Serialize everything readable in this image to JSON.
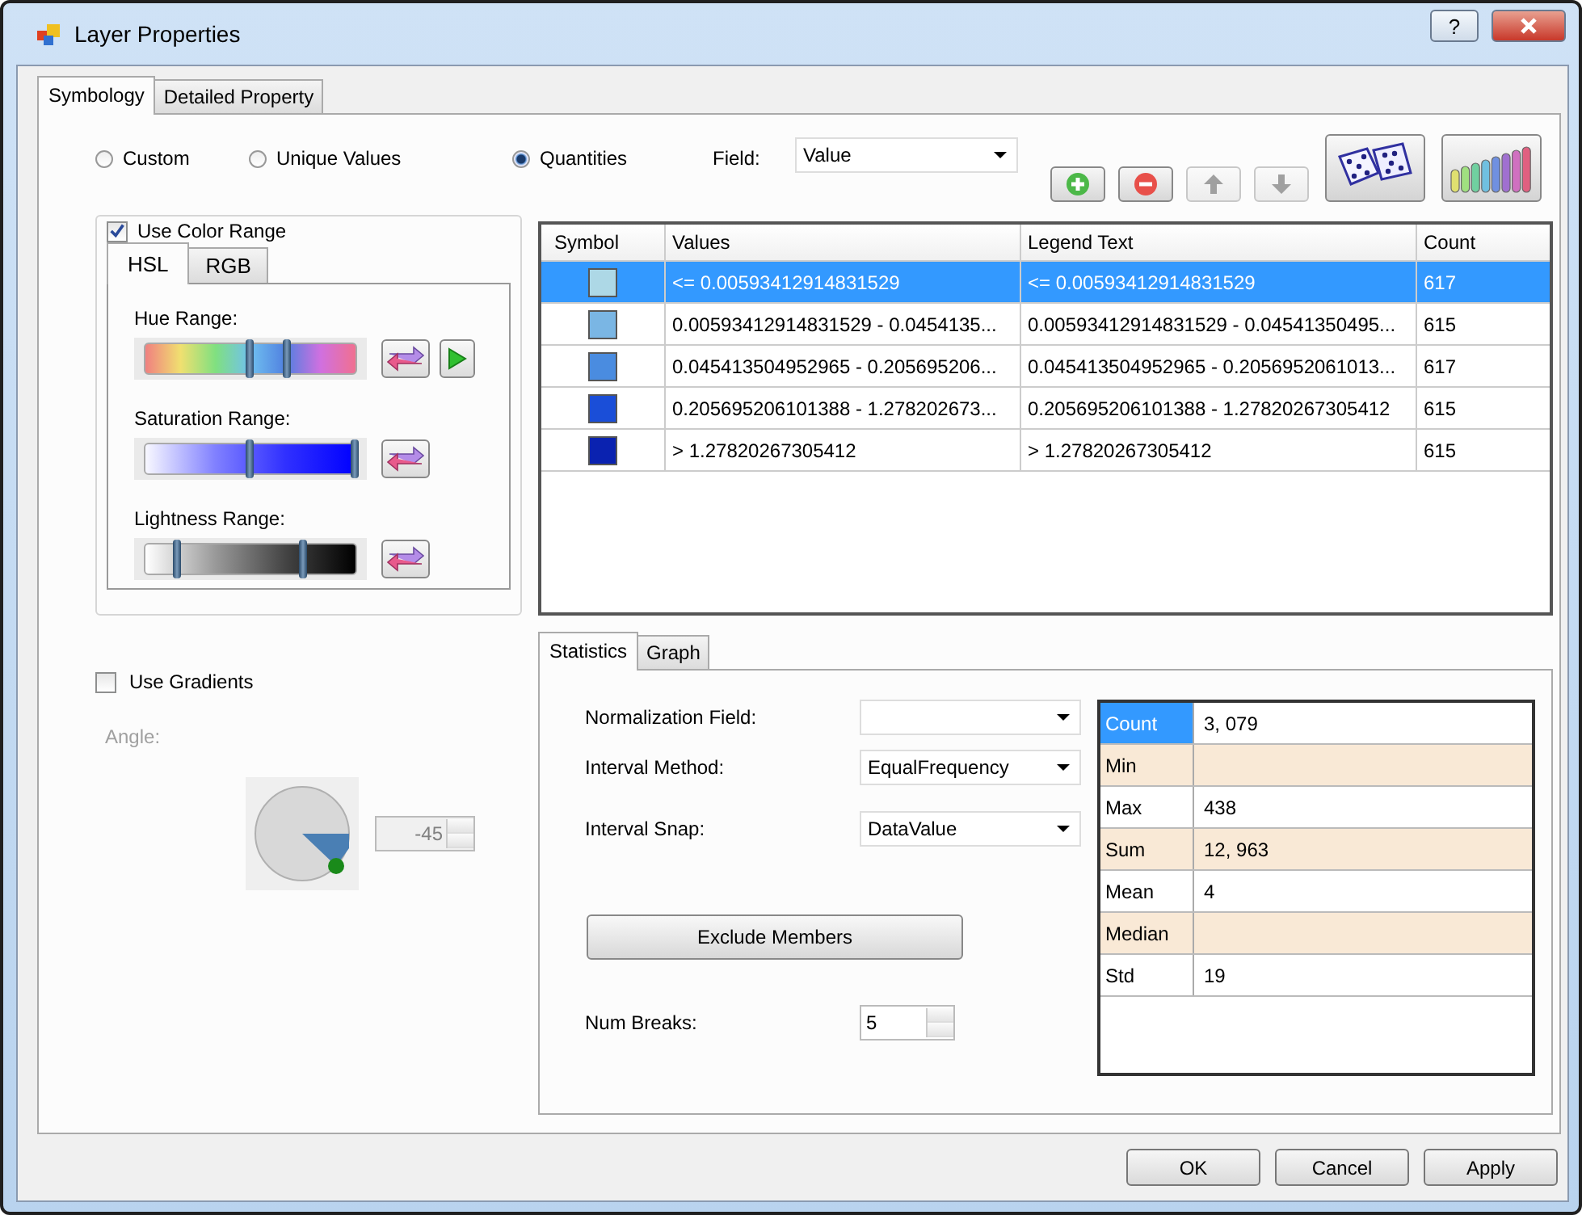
{
  "window": {
    "title": "Layer Properties",
    "help_button": "?"
  },
  "tabs": [
    {
      "label": "Symbology",
      "selected": true
    },
    {
      "label": "Detailed Property",
      "selected": false
    }
  ],
  "scheme_options": [
    {
      "label": "Custom",
      "selected": false
    },
    {
      "label": "Unique Values",
      "selected": false
    },
    {
      "label": "Quantities",
      "selected": true
    }
  ],
  "field": {
    "label": "Field:",
    "value": "Value"
  },
  "toolbar": [
    {
      "kind": "add",
      "disabled": false
    },
    {
      "kind": "remove",
      "disabled": false
    },
    {
      "kind": "up",
      "disabled": true
    },
    {
      "kind": "down",
      "disabled": true
    },
    {
      "kind": "random"
    },
    {
      "kind": "ramp"
    }
  ],
  "color_range": {
    "label": "Use Color Range",
    "checked": true,
    "tabs": [
      {
        "label": "HSL",
        "selected": true
      },
      {
        "label": "RGB",
        "selected": false
      }
    ],
    "sliders": [
      {
        "label": "Hue Range:",
        "kind": "hue",
        "low": {
          "level": 0.5
        },
        "high": {
          "level": 0.68
        },
        "play": true
      },
      {
        "label": "Saturation Range:",
        "kind": "saturation",
        "low": {
          "level": 0.5
        },
        "high": {
          "level": 1.0
        },
        "play": false
      },
      {
        "label": "Lightness Range:",
        "kind": "lightness",
        "low": {
          "level": 0.15
        },
        "high": {
          "level": 0.75
        },
        "play": false
      }
    ]
  },
  "gradients": {
    "label": "Use Gradients",
    "checked": false,
    "angle_label": "Angle:",
    "angle_value": "-45",
    "disabled": true
  },
  "table": {
    "columns": [
      "Symbol",
      "Values",
      "Legend Text",
      "Count"
    ],
    "rows": [
      {
        "color": "#add8e6",
        "values": "<= 0.00593412914831529",
        "legend": "<= 0.00593412914831529",
        "count": "617",
        "selected": true
      },
      {
        "color": "#7ab6e4",
        "values": "0.00593412914831529 - 0.0454135...",
        "legend": "0.00593412914831529 - 0.04541350495...",
        "count": "615",
        "selected": false
      },
      {
        "color": "#4a8ce0",
        "values": "0.045413504952965 - 0.205695206...",
        "legend": "0.045413504952965 - 0.2056952061013...",
        "count": "617",
        "selected": false
      },
      {
        "color": "#1a4ed8",
        "values": "0.205695206101388 - 1.278202673...",
        "legend": "0.205695206101388 - 1.27820267305412",
        "count": "615",
        "selected": false
      },
      {
        "color": "#0a22b0",
        "values": "> 1.27820267305412",
        "legend": "> 1.27820267305412",
        "count": "615",
        "selected": false
      }
    ]
  },
  "stats_tabs": [
    {
      "label": "Statistics",
      "selected": true
    },
    {
      "label": "Graph",
      "selected": false
    }
  ],
  "normalization_field": {
    "label": "Normalization Field:"
  },
  "interval_method": {
    "label": "Interval Method:",
    "value": "EqualFrequency"
  },
  "interval_snap": {
    "label": "Interval Snap:",
    "value": "DataValue"
  },
  "exclude_button": "Exclude Members",
  "num_breaks": {
    "label": "Num Breaks:",
    "value": "5"
  },
  "statistics": [
    {
      "name": "Count",
      "value": "3, 079",
      "selected": true
    },
    {
      "name": "Min",
      "selected": false
    },
    {
      "name": "Max",
      "value": "438",
      "selected": false
    },
    {
      "name": "Sum",
      "value": "12, 963",
      "selected": false
    },
    {
      "name": "Mean",
      "value": "4",
      "selected": false
    },
    {
      "name": "Median",
      "selected": false
    },
    {
      "name": "Std",
      "value": "19",
      "selected": false
    }
  ],
  "buttons": [
    "OK",
    "Cancel",
    "Apply"
  ]
}
